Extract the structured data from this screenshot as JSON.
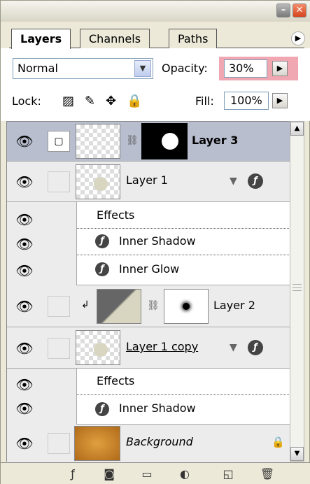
{
  "window": {
    "minimize_glyph": "–",
    "close_glyph": "✕"
  },
  "tabs": [
    {
      "label": "Layers"
    },
    {
      "label": "Channels"
    },
    {
      "label": "Paths"
    }
  ],
  "blend_mode": {
    "value": "Normal"
  },
  "opacity": {
    "label": "Opacity:",
    "value": "30%"
  },
  "lock": {
    "label": "Lock:"
  },
  "fill": {
    "label": "Fill:",
    "value": "100%"
  },
  "layers": [
    {
      "name": "Layer 3",
      "selected": true
    },
    {
      "name": "Layer 1",
      "effects_label": "Effects",
      "effects": [
        "Inner Shadow",
        "Inner Glow"
      ]
    },
    {
      "name": "Layer 2"
    },
    {
      "name": "Layer 1 copy",
      "effects_label": "Effects",
      "effects": [
        "Inner Shadow"
      ]
    },
    {
      "name": "Background"
    }
  ],
  "icons": {
    "eye": "eye-icon",
    "fx": "fx-icon",
    "link": "chain-link-icon",
    "lock": "lock-icon",
    "collapse": "triangle-down-icon",
    "clip": "clipping-arrow-icon"
  },
  "colors": {
    "opacity_highlight": "#f1a7b2",
    "selected_row": "#b8bece"
  }
}
